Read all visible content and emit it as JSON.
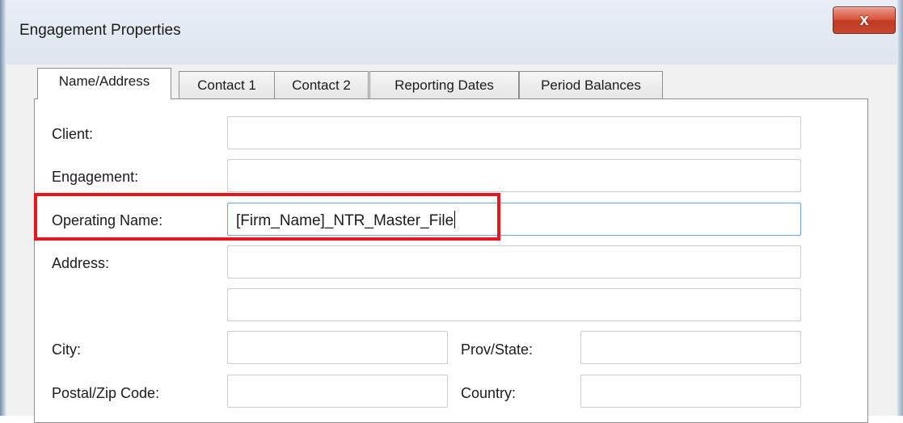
{
  "window": {
    "title": "Engagement Properties",
    "close_label": "x"
  },
  "tabs": [
    {
      "label": "Name/Address",
      "active": true
    },
    {
      "label": "Contact 1",
      "active": false
    },
    {
      "label": "Contact 2",
      "active": false
    },
    {
      "label": "Reporting Dates",
      "active": false
    },
    {
      "label": "Period Balances",
      "active": false
    }
  ],
  "form": {
    "client_label": "Client:",
    "client_value": "",
    "engagement_label": "Engagement:",
    "engagement_value": "",
    "operating_name_label": "Operating Name:",
    "operating_name_value": "[Firm_Name]_NTR_Master_File",
    "address_label": "Address:",
    "address_line1_value": "",
    "address_line2_value": "",
    "city_label": "City:",
    "city_value": "",
    "prov_state_label": "Prov/State:",
    "prov_state_value": "",
    "postal_zip_label": "Postal/Zip Code:",
    "postal_zip_value": "",
    "country_label": "Country:",
    "country_value": ""
  },
  "colors": {
    "highlight": "#e8161c",
    "close_button": "#c9462f",
    "focus_border": "#6fa3d9"
  }
}
